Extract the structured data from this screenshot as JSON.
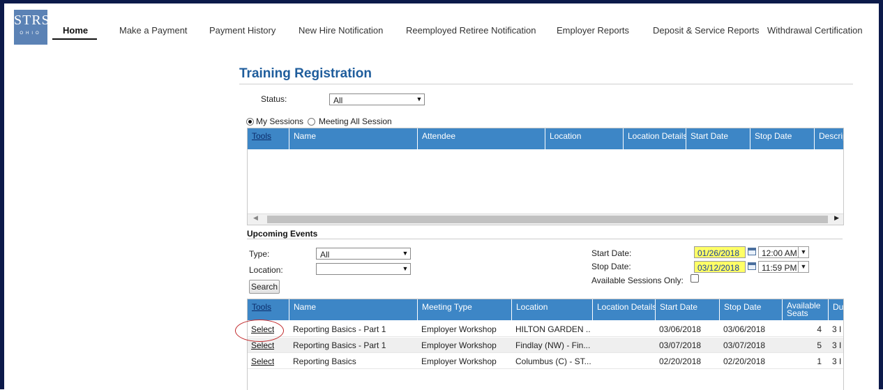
{
  "nav": {
    "logo_main": "STRS",
    "logo_sub": "OHIO",
    "items": [
      {
        "label": "Home",
        "active": true
      },
      {
        "label": "Make a Payment"
      },
      {
        "label": "Payment History"
      },
      {
        "label": "New Hire Notification"
      },
      {
        "label": "Reemployed Retiree Notification"
      },
      {
        "label": "Employer Reports"
      },
      {
        "label": "Deposit & Service Reports"
      },
      {
        "label": "Withdrawal Certification"
      }
    ]
  },
  "page": {
    "title": "Training Registration",
    "status_label": "Status:",
    "status_value": "All",
    "radio_my": "My Sessions",
    "radio_all": "Meeting All Session"
  },
  "sessions_grid": {
    "headers": [
      "Tools",
      "Name",
      "Attendee",
      "Location",
      "Location Details",
      "Start Date",
      "Stop Date",
      "Descrip"
    ]
  },
  "upcoming": {
    "title": "Upcoming Events",
    "type_label": "Type:",
    "type_value": "All",
    "location_label": "Location:",
    "location_value": "",
    "search_label": "Search",
    "start_label": "Start Date:",
    "start_date": "01/26/2018",
    "start_time": "12:00 AM",
    "stop_label": "Stop Date:",
    "stop_date": "03/12/2018",
    "stop_time": "11:59 PM",
    "available_label": "Available Sessions Only:"
  },
  "events_grid": {
    "headers": [
      "Tools",
      "Name",
      "Meeting Type",
      "Location",
      "Location Details",
      "Start Date",
      "Stop Date",
      "Available Seats",
      "Du"
    ],
    "rows": [
      {
        "tools": "Select",
        "name": "Reporting Basics - Part 1",
        "type": "Employer Workshop",
        "location": "HILTON GARDEN ...",
        "details": "",
        "start": "03/06/2018",
        "stop": "03/06/2018",
        "seats": "4",
        "dur": "3 I"
      },
      {
        "tools": "Select",
        "name": "Reporting Basics - Part 1",
        "type": "Employer Workshop",
        "location": "Findlay (NW) - Fin...",
        "details": "",
        "start": "03/07/2018",
        "stop": "03/07/2018",
        "seats": "5",
        "dur": "3 I"
      },
      {
        "tools": "Select",
        "name": "Reporting Basics",
        "type": "Employer Workshop",
        "location": "Columbus (C) - ST...",
        "details": "",
        "start": "02/20/2018",
        "stop": "02/20/2018",
        "seats": "1",
        "dur": "3 I"
      }
    ]
  },
  "colors": {
    "header_blue": "#3d86c6",
    "title_blue": "#1f5d9c",
    "frame": "#0c1a4a",
    "date_highlight": "#ffff66",
    "annotation": "#c0282a"
  }
}
